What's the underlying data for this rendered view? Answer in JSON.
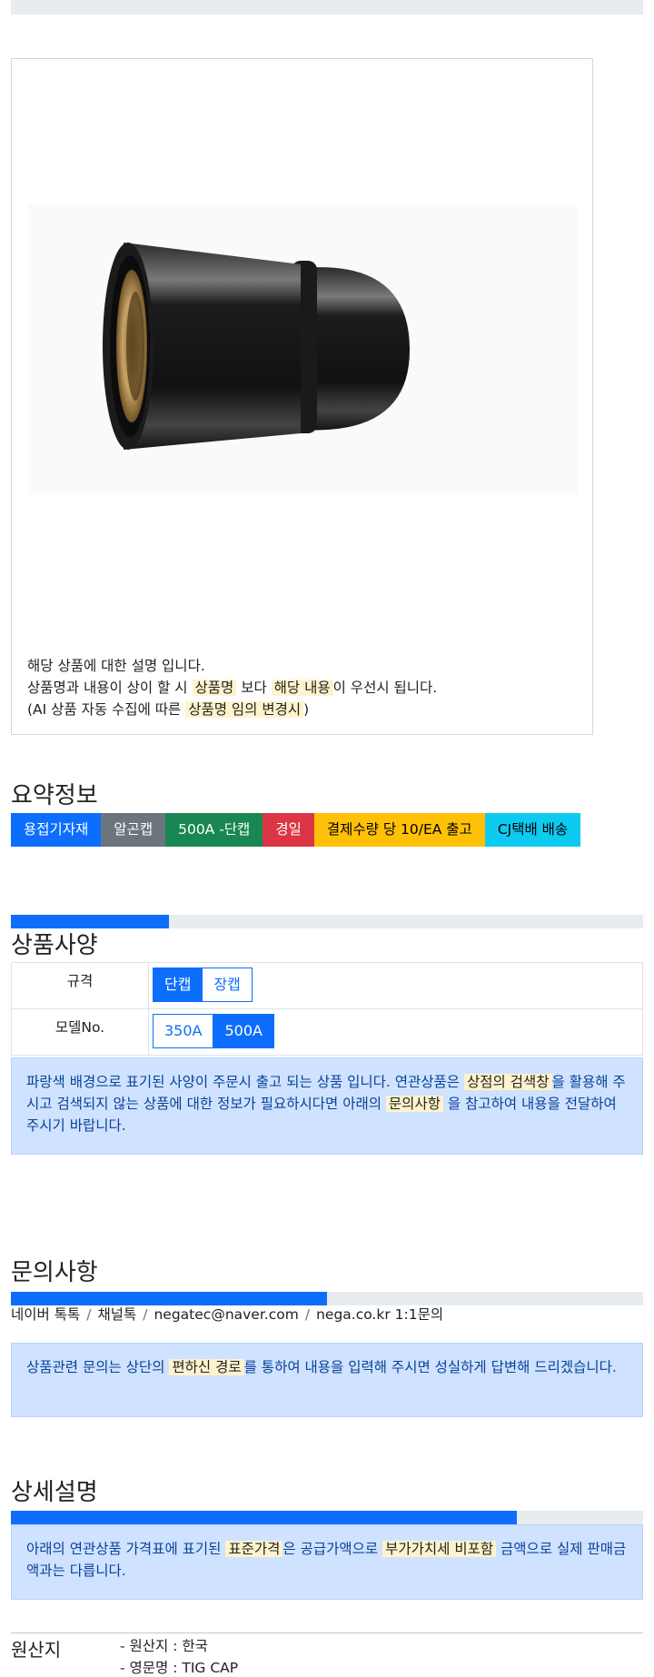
{
  "description": {
    "line1": "해당 상품에 대한 설명 입니다.",
    "line2_a": "상품명과 내용이 상이 할 시 ",
    "line2_hl1": "상품명",
    "line2_b": " 보다 ",
    "line2_hl2": "해당 내용",
    "line2_c": "이 우선시 됩니다.",
    "line3_a": "(AI 상품 자동 수집에 따른 ",
    "line3_hl": "상품명 임의 변경시",
    "line3_b": ")"
  },
  "summary": {
    "title": "요약정보",
    "badges": [
      {
        "label": "용접기자재",
        "color": "#0d6efd",
        "text_color": "#ffffff"
      },
      {
        "label": "알곤캡",
        "color": "#6c757d",
        "text_color": "#ffffff"
      },
      {
        "label": "500A -단캡",
        "color": "#198754",
        "text_color": "#ffffff"
      },
      {
        "label": "경일",
        "color": "#dc3545",
        "text_color": "#ffffff"
      },
      {
        "label": "결제수량 당 10/EA 출고",
        "color": "#ffc107",
        "text_color": "#000000"
      },
      {
        "label": "CJ택배 배송",
        "color": "#0dcaf0",
        "text_color": "#000000"
      }
    ]
  },
  "spec": {
    "title": "상품사양",
    "progress": 0.25,
    "rows": [
      {
        "label": "규격",
        "options": [
          {
            "label": "단캡",
            "selected": true
          },
          {
            "label": "장캡",
            "selected": false
          }
        ]
      },
      {
        "label": "모델No.",
        "options": [
          {
            "label": "350A",
            "selected": false
          },
          {
            "label": "500A",
            "selected": true
          }
        ]
      }
    ],
    "notice_a": "파랑색 배경으로 표기된 사양이 주문시 출고 되는 상품 입니다. 연관상품은 ",
    "notice_hl1": "상점의 검색창",
    "notice_b": "을 활용해 주시고 검색되지 않는 상품에 대한 정보가 필요하시다면 아래의 ",
    "notice_hl2": "문의사항",
    "notice_c": " 을 참고하여 내용을 전달하여 주시기 바랍니다."
  },
  "inquiry": {
    "title": "문의사항",
    "progress": 0.5,
    "links": [
      "네이버 톡톡",
      "채널톡",
      "negatec@naver.com",
      "nega.co.kr 1:1문의"
    ],
    "separator": "/",
    "notice_a": "상품관련 문의는 상단의 ",
    "notice_hl": "편하신 경로",
    "notice_b": "를 통하여 내용을 입력해 주시면 성실하게 답변해 드리겠습니다."
  },
  "detail": {
    "title": "상세설명",
    "progress": 0.8,
    "notice_a": "아래의 연관상품 가격표에 표기된 ",
    "notice_hl1": "표준가격",
    "notice_b": "은 공급가액으로 ",
    "notice_hl2": "부가가치세 비포함",
    "notice_c": " 금액으로 실제 판매금액과는 다릅니다."
  },
  "origin": {
    "label": "원산지",
    "line1": "- 원산지 : 한국",
    "line2": "- 영문명 : TIG CAP"
  }
}
